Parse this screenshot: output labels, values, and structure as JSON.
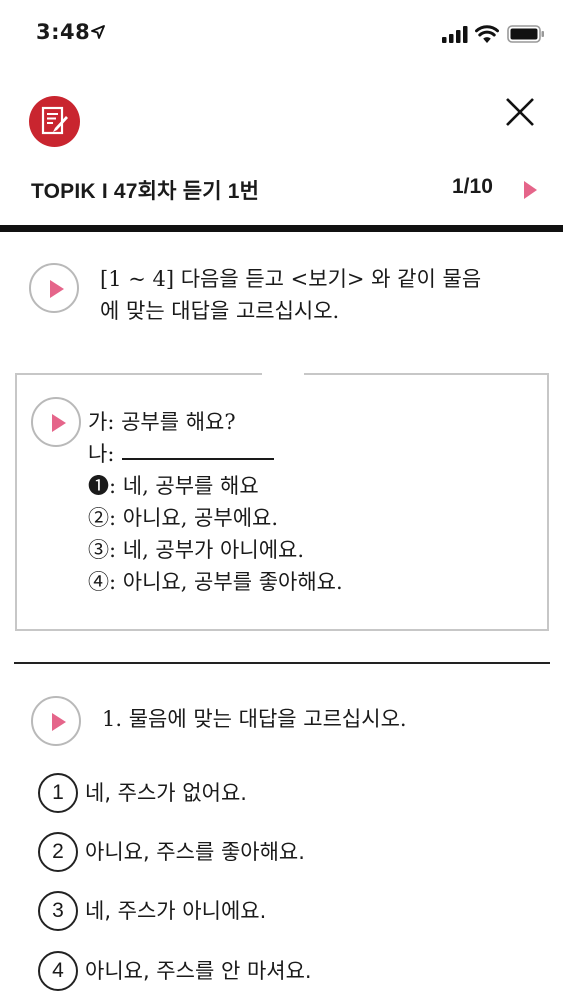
{
  "status_bar": {
    "time": "3:48"
  },
  "header": {
    "title": "TOPIK I 47회차 듣기 1번",
    "page_counter": "1/10",
    "accent_color": "#e5658a",
    "logo_color": "#c9252f",
    "icons": [
      "document-edit-icon",
      "close-icon",
      "next-arrow-icon"
    ]
  },
  "instruction": {
    "line1": "[1 ~ 4] 다음을 듣고 <보기> 와 같이 물음",
    "line2": "에 맞는 대답을 고르십시오."
  },
  "example": {
    "ga": "가: 공부를 해요?",
    "na": "나:",
    "choices": [
      "❶: 네, 공부를 해요",
      "②: 아니요, 공부에요.",
      "③: 네, 공부가 아니에요.",
      "④: 아니요, 공부를 좋아해요."
    ]
  },
  "question": {
    "text": "1. 물음에 맞는 대답을 고르십시오.",
    "options": [
      {
        "num": "1",
        "text": "네, 주스가 없어요."
      },
      {
        "num": "2",
        "text": "아니요, 주스를 좋아해요."
      },
      {
        "num": "3",
        "text": "네, 주스가 아니에요."
      },
      {
        "num": "4",
        "text": "아니요, 주스를 안 마셔요."
      }
    ]
  }
}
